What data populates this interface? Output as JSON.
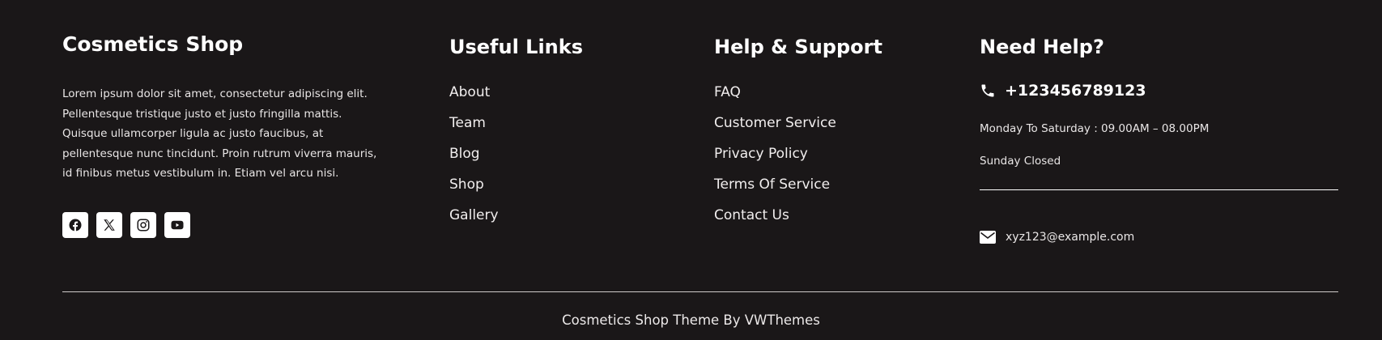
{
  "about": {
    "title": "Cosmetics Shop",
    "text": "Lorem ipsum dolor sit amet, consectetur adipiscing elit. Pellentesque tristique justo et justo fringilla mattis. Quisque ullamcorper ligula ac justo faucibus, at pellentesque nunc tincidunt. Proin rutrum viverra mauris, id finibus metus vestibulum in. Etiam vel arcu nisi.",
    "socials": [
      {
        "name": "facebook-icon"
      },
      {
        "name": "x-twitter-icon"
      },
      {
        "name": "instagram-icon"
      },
      {
        "name": "youtube-icon"
      }
    ]
  },
  "useful_links": {
    "heading": "Useful Links",
    "items": [
      "About",
      "Team",
      "Blog",
      "Shop",
      "Gallery"
    ]
  },
  "help_support": {
    "heading": "Help & Support",
    "items": [
      "FAQ",
      "Customer Service",
      "Privacy Policy",
      "Terms Of Service",
      "Contact Us"
    ]
  },
  "need_help": {
    "heading": "Need Help?",
    "phone": "+123456789123",
    "hours_weekday": "Monday To Saturday : 09.00AM – 08.00PM",
    "hours_sunday": "Sunday Closed",
    "email": "xyz123@example.com",
    "icons": {
      "phone": "phone-icon",
      "email": "envelope-icon"
    }
  },
  "footer": {
    "copyright": "Cosmetics Shop Theme By VWThemes"
  },
  "colors": {
    "background": "#1a1718",
    "text": "#ffffff",
    "social_button_bg": "#ffffff"
  }
}
